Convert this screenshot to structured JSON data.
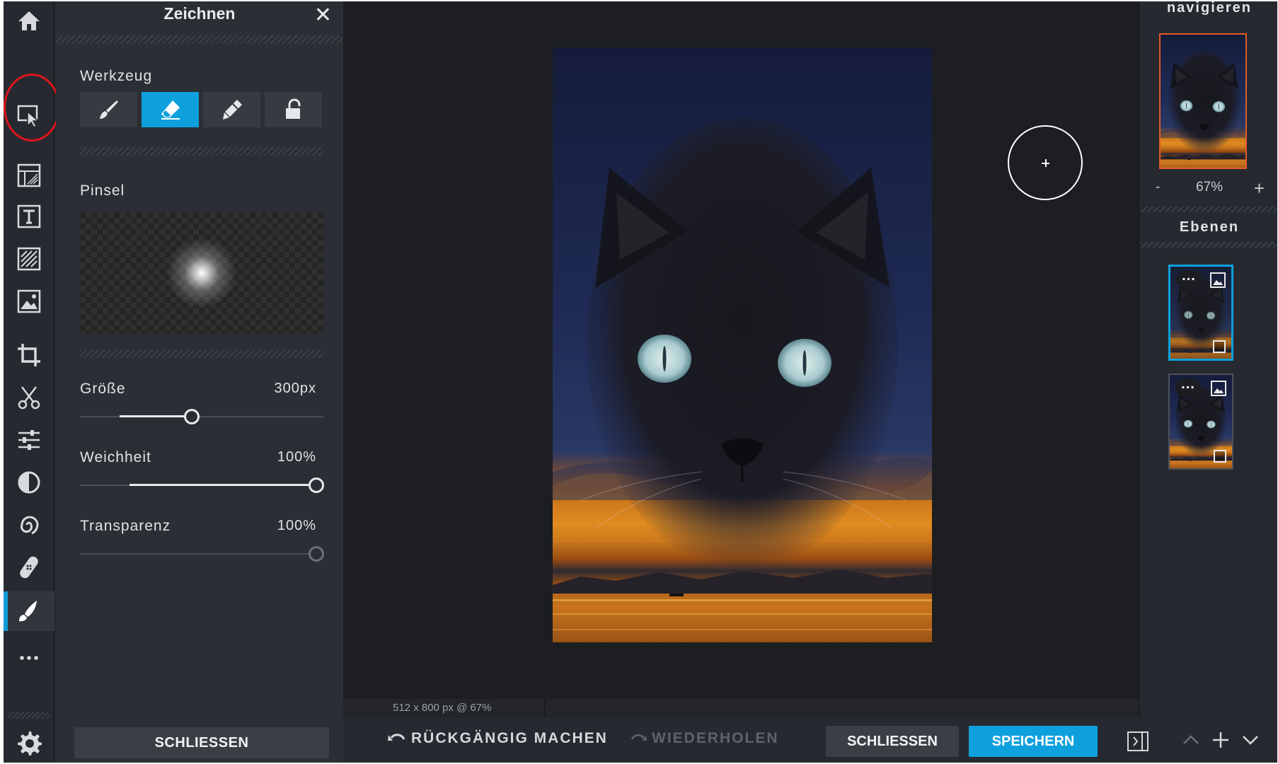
{
  "panel": {
    "title": "Zeichnen",
    "tool_section_label": "Werkzeug",
    "tools": [
      {
        "name": "brush-icon",
        "label": "Pinsel-Werkzeug",
        "active": false
      },
      {
        "name": "eraser-icon",
        "label": "Radierer",
        "active": true
      },
      {
        "name": "pen-icon",
        "label": "Stift",
        "active": false
      },
      {
        "name": "lock-icon",
        "label": "Sperre",
        "active": false
      }
    ],
    "brush_section_label": "Pinsel",
    "sliders": {
      "size": {
        "label": "Größe",
        "value": "300px",
        "fraction": 0.46
      },
      "softness": {
        "label": "Weichheit",
        "value": "100%",
        "fraction": 1.0
      },
      "transparency": {
        "label": "Transparenz",
        "value": "100%",
        "fraction": 1.0
      }
    },
    "close_button": "SCHLIESSEN"
  },
  "rail": {
    "icons": [
      "home-icon",
      "select-icon",
      "layers-icon",
      "text-icon",
      "pattern-icon",
      "image-icon",
      "crop-icon",
      "cut-icon",
      "adjust-icon",
      "contrast-icon",
      "swirl-icon",
      "heal-icon",
      "draw-icon",
      "more-icon",
      "settings-icon"
    ],
    "active": "draw-icon"
  },
  "canvas": {
    "status": "512 x 800 px @ 67%"
  },
  "bottom_bar": {
    "undo": "RÜCKGÄNGIG MACHEN",
    "redo": "WIEDERHOLEN",
    "close": "SCHLIESSEN",
    "save": "SPEICHERN"
  },
  "right_panel": {
    "navigate_title": "navigieren",
    "zoom": {
      "minus": "-",
      "value": "67%",
      "plus": "+"
    },
    "layers_title": "Ebenen",
    "layers_count": 2,
    "active_layer": 0
  },
  "colors": {
    "accent": "#0ea0dd",
    "panel_bg": "#2b2f35",
    "rail_bg": "#262a30",
    "canvas_bg": "#1d1e21",
    "highlight_ring": "#e0141c"
  }
}
